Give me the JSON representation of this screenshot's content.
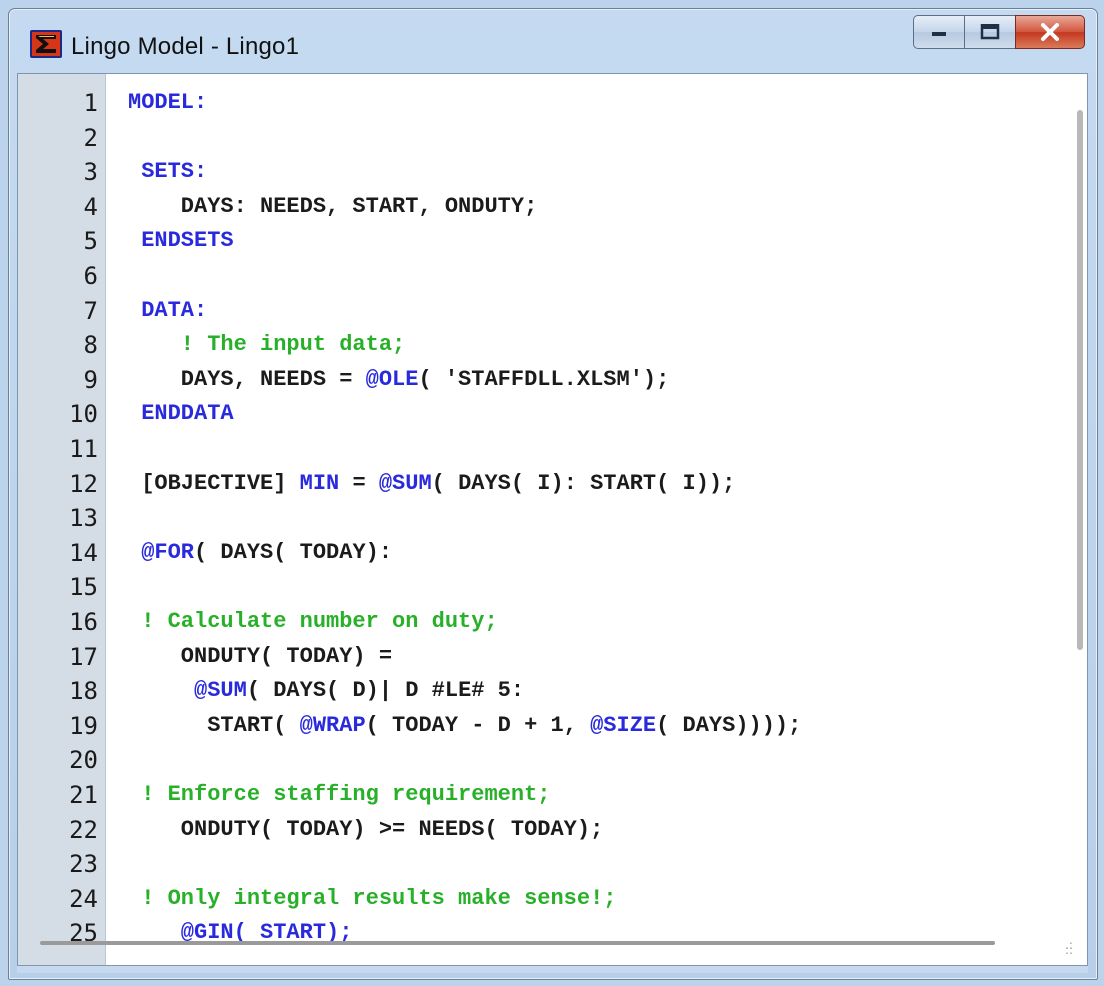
{
  "window": {
    "title": "Lingo Model - Lingo1",
    "icon": "lingo-sigma-icon",
    "buttons": {
      "minimize": "minimize-icon",
      "maximize": "maximize-icon",
      "close": "close-icon"
    }
  },
  "editor": {
    "colors": {
      "keyword": "#2a2add",
      "comment": "#28b028",
      "text": "#1b1b1b",
      "gutter": "#d4dce6"
    },
    "line_numbers": [
      "1",
      "2",
      "3",
      "4",
      "5",
      "6",
      "7",
      "8",
      "9",
      "10",
      "11",
      "12",
      "13",
      "14",
      "15",
      "16",
      "17",
      "18",
      "19",
      "20",
      "21",
      "22",
      "23",
      "24",
      "25"
    ],
    "lines": [
      [
        {
          "t": "MODEL:",
          "c": "kw"
        }
      ],
      [],
      [
        {
          "t": " SETS:",
          "c": "kw"
        }
      ],
      [
        {
          "t": "    DAYS: NEEDS, START, ONDUTY;",
          "c": "tx"
        }
      ],
      [
        {
          "t": " ENDSETS",
          "c": "kw"
        }
      ],
      [],
      [
        {
          "t": " DATA:",
          "c": "kw"
        }
      ],
      [
        {
          "t": "    ! The input data;",
          "c": "cm"
        }
      ],
      [
        {
          "t": "    DAYS, NEEDS = ",
          "c": "tx"
        },
        {
          "t": "@OLE",
          "c": "kw"
        },
        {
          "t": "( 'STAFFDLL.XLSM');",
          "c": "tx"
        }
      ],
      [
        {
          "t": " ENDDATA",
          "c": "kw"
        }
      ],
      [],
      [
        {
          "t": " [OBJECTIVE] ",
          "c": "tx"
        },
        {
          "t": "MIN",
          "c": "kw"
        },
        {
          "t": " = ",
          "c": "tx"
        },
        {
          "t": "@SUM",
          "c": "kw"
        },
        {
          "t": "( DAYS( I): START( I));",
          "c": "tx"
        }
      ],
      [],
      [
        {
          "t": " @FOR",
          "c": "kw"
        },
        {
          "t": "( DAYS( TODAY):",
          "c": "tx"
        }
      ],
      [],
      [
        {
          "t": " ! Calculate number on duty;",
          "c": "cm"
        }
      ],
      [
        {
          "t": "    ONDUTY( TODAY) =",
          "c": "tx"
        }
      ],
      [
        {
          "t": "     @SUM",
          "c": "kw"
        },
        {
          "t": "( DAYS( D)| D #LE# 5:",
          "c": "tx"
        }
      ],
      [
        {
          "t": "      START( ",
          "c": "tx"
        },
        {
          "t": "@WRAP",
          "c": "kw"
        },
        {
          "t": "( TODAY - D + 1, ",
          "c": "tx"
        },
        {
          "t": "@SIZE",
          "c": "kw"
        },
        {
          "t": "( DAYS))));",
          "c": "tx"
        }
      ],
      [],
      [
        {
          "t": " ! Enforce staffing requirement;",
          "c": "cm"
        }
      ],
      [
        {
          "t": "    ONDUTY( TODAY) >= NEEDS( TODAY);",
          "c": "tx"
        }
      ],
      [],
      [
        {
          "t": " ! Only integral results make sense!;",
          "c": "cm"
        }
      ],
      [
        {
          "t": "    @GIN( START);",
          "c": "kw"
        }
      ]
    ]
  }
}
